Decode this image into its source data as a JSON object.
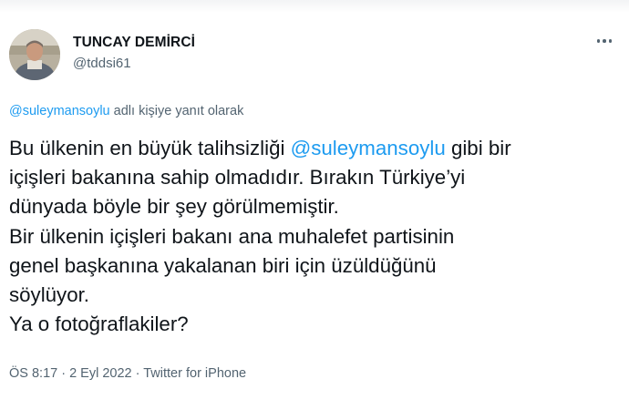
{
  "author": {
    "display_name": "TUNCAY DEMİRCİ",
    "handle": "@tddsi61",
    "avatar_icon": "profile-photo"
  },
  "more_icon": "more-horizontal-icon",
  "reply_context": {
    "mention": "@suleymansoylu",
    "text": " adlı kişiye yanıt olarak"
  },
  "tweet": {
    "line1_before": "Bu ülkenin en büyük talihsizliği ",
    "line1_mention": "@suleymansoylu",
    "line1_after": " gibi bir",
    "line2": "içişleri bakanına sahip olmadıdır. Bırakın Türkiye’yi",
    "line3": "dünyada böyle bir şey görülmemiştir.",
    "line4": "Bir ülkenin içişleri bakanı ana muhalefet partisinin",
    "line5": "genel başkanına yakalanan biri için üzüldüğünü",
    "line6": "söylüyor.",
    "line7": "Ya o fotoğraflakiler?"
  },
  "meta": {
    "time": "ÖS 8:17",
    "separator1": " · ",
    "date": "2 Eyl 2022",
    "separator2": " · ",
    "source": "Twitter for iPhone"
  },
  "colors": {
    "link": "#1d9bf0",
    "text": "#0f1419",
    "secondary": "#536471"
  }
}
